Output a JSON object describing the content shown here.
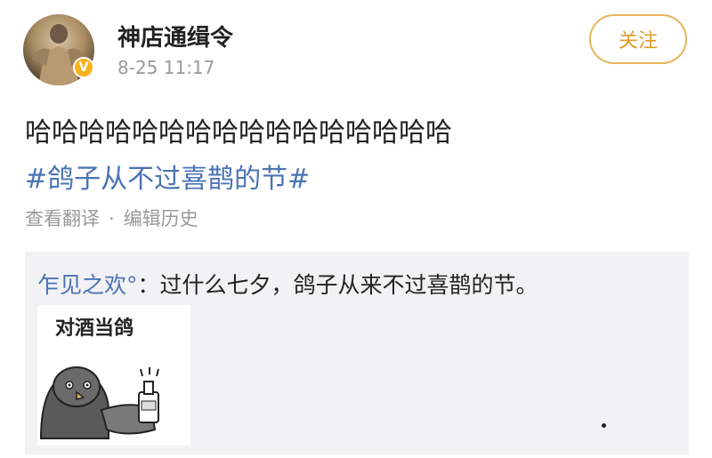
{
  "post": {
    "username": "神店通缉令",
    "timestamp": "8-25 11:17",
    "follow_label": "关注",
    "text": "哈哈哈哈哈哈哈哈哈哈哈哈哈哈哈哈",
    "hashtag": "#鸽子从不过喜鹊的节#",
    "translate_label": "查看翻译",
    "separator": "·",
    "edit_history_label": "编辑历史"
  },
  "quoted": {
    "user": "乍见之欢°",
    "colon": "：",
    "text": "过什么七夕，鸽子从来不过喜鹊的节。",
    "meme_caption": "对酒当鸽"
  },
  "colors": {
    "link": "#4a73b5",
    "follow": "#e09a2a",
    "verified": "#f6b21a"
  }
}
